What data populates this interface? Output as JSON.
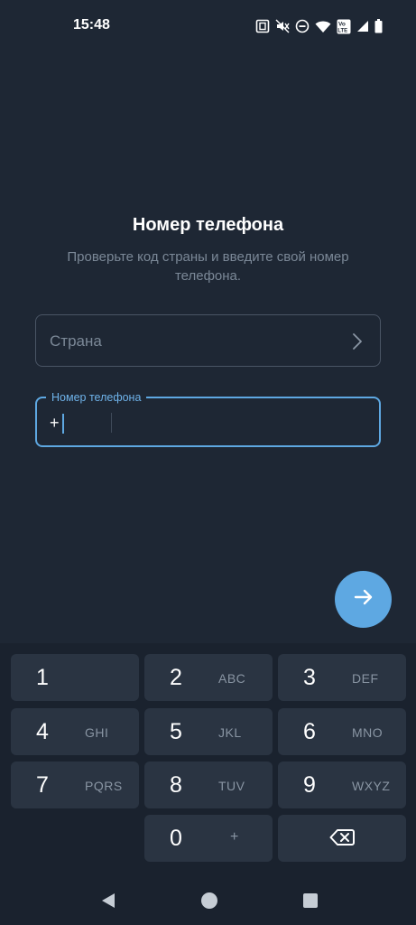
{
  "status_bar": {
    "time": "15:48",
    "icons": [
      "nfc-icon",
      "mute-icon",
      "dnd-icon",
      "wifi-icon",
      "volte-icon",
      "signal-icon",
      "battery-icon"
    ],
    "volte_text": "Vo LTE"
  },
  "header": {
    "title": "Номер телефона",
    "subtitle": "Проверьте код страны и введите свой номер телефона."
  },
  "country_field": {
    "placeholder": "Страна",
    "icon": "chevron-right-icon"
  },
  "phone_field": {
    "label": "Номер телефона",
    "prefix": "+",
    "value": ""
  },
  "fab": {
    "icon": "arrow-right-icon"
  },
  "keypad": {
    "keys": [
      {
        "digit": "1",
        "letters": ""
      },
      {
        "digit": "2",
        "letters": "ABC"
      },
      {
        "digit": "3",
        "letters": "DEF"
      },
      {
        "digit": "4",
        "letters": "GHI"
      },
      {
        "digit": "5",
        "letters": "JKL"
      },
      {
        "digit": "6",
        "letters": "MNO"
      },
      {
        "digit": "7",
        "letters": "PQRS"
      },
      {
        "digit": "8",
        "letters": "TUV"
      },
      {
        "digit": "9",
        "letters": "WXYZ"
      },
      {
        "digit": "0",
        "letters": "+"
      }
    ],
    "backspace_icon": "backspace-icon"
  },
  "nav_bar": {
    "icons": [
      "back-icon",
      "home-icon",
      "recents-icon"
    ]
  },
  "colors": {
    "background": "#1e2734",
    "accent": "#5ea8e2",
    "key_background": "#2a3442",
    "keypad_background": "#1a222e",
    "muted_text": "#7b8897"
  }
}
